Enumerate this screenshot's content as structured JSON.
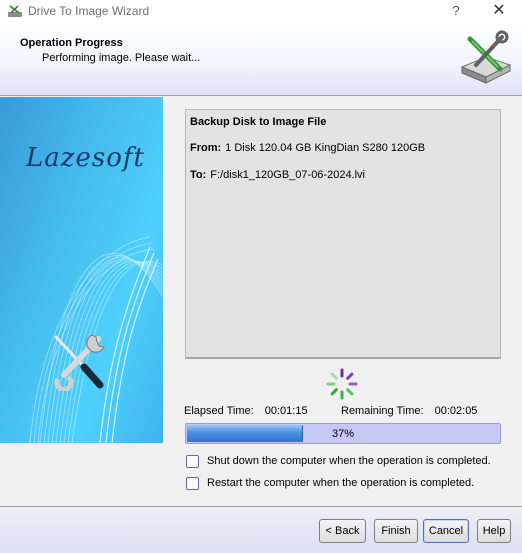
{
  "window": {
    "title": "Drive To Image Wizard",
    "help_glyph": "?",
    "close_glyph": "✕"
  },
  "header": {
    "title": "Operation Progress",
    "subtitle": "Performing image. Please wait...",
    "icon": "disk-tools-icon"
  },
  "sidebar": {
    "logo_text": "Lazesoft",
    "icon": "wrench-screwdriver-icon"
  },
  "info": {
    "operation": "Backup Disk to Image File",
    "from_label": "From:",
    "from_value": "1 Disk 120.04 GB KingDian S280 120GB",
    "to_label": "To:",
    "to_value": "F:/disk1_120GB_07-06-2024.lvi"
  },
  "status": {
    "elapsed_label": "Elapsed Time:",
    "elapsed_value": "00:01:15",
    "remaining_label": "Remaining Time:",
    "remaining_value": "00:02:05"
  },
  "progress": {
    "percent_text": "37%",
    "fraction": 0.37
  },
  "options": {
    "shutdown_label": "Shut down the computer when the operation is completed.",
    "restart_label": "Restart the computer when the operation is completed."
  },
  "buttons": {
    "back": "< Back",
    "finish": "Finish",
    "cancel": "Cancel",
    "help": "Help"
  },
  "colors": {
    "progress_fill": "#3b7fd8",
    "progress_track": "#c7c7f5",
    "sidebar_blue": "#46bdf0"
  }
}
